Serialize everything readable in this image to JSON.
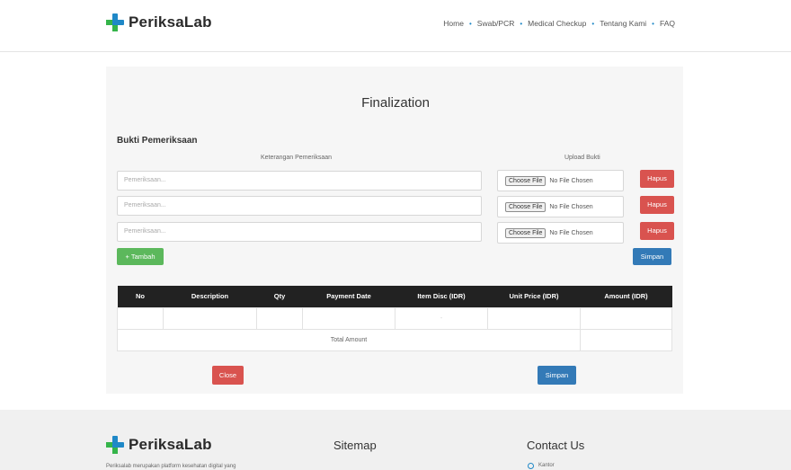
{
  "brand": {
    "name": "PeriksaLab"
  },
  "nav": {
    "items": [
      "Home",
      "Swab/PCR",
      "Medical Checkup",
      "Tentang Kami",
      "FAQ"
    ],
    "separator": "•"
  },
  "page": {
    "title": "Finalization",
    "section_title": "Bukti Pemeriksaan",
    "col_keterangan": "Keterangan Pemeriksaan",
    "col_upload": "Upload Bukti"
  },
  "rows": [
    {
      "placeholder": "Pemeriksaan...",
      "file_button": "Choose File",
      "file_status": "No File Chosen",
      "delete_label": "Hapus"
    },
    {
      "placeholder": "Pemeriksaan...",
      "file_button": "Choose File",
      "file_status": "No File Chosen",
      "delete_label": "Hapus"
    },
    {
      "placeholder": "Pemeriksaan...",
      "file_button": "Choose File",
      "file_status": "No File Chosen",
      "delete_label": "Hapus"
    }
  ],
  "actions": {
    "add_label": "+ Tambah",
    "save_label": "Simpan",
    "close_label": "Close",
    "save_bottom_label": "Simpan"
  },
  "table": {
    "headers": [
      "No",
      "Description",
      "Qty",
      "Payment Date",
      "Item Disc (IDR)",
      "Unit Price (IDR)",
      "Amount (IDR)"
    ],
    "row": [
      "",
      "",
      "",
      "",
      "-",
      "",
      ""
    ],
    "total_label": "Total Amount",
    "total_value": ""
  },
  "footer": {
    "sitemap": "Sitemap",
    "contact": "Contact Us",
    "about_text": "Periksalab merupakan platform kesehatan digital yang",
    "contact_item": "Kantor"
  },
  "colors": {
    "brand_blue": "#1f88c7",
    "brand_green": "#35b44a",
    "danger": "#d9534f",
    "success": "#5cb85c",
    "primary": "#337ab7"
  }
}
